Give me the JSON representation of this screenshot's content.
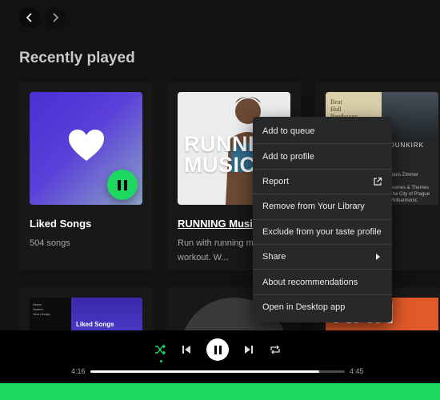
{
  "section": {
    "title": "Recently played"
  },
  "cards": [
    {
      "title": "Liked Songs",
      "subtitle": "504 songs"
    },
    {
      "title": "RUNNING Music",
      "subtitle": "Run with running m... in your workout. W...",
      "cover_text": "RUNNING MUSIC"
    },
    {
      "title": "",
      "subtitle": "",
      "cover_text": "DUNKIRK",
      "credit1": "Hans Zimmer",
      "credit2": "Scenes & Themes",
      "credit3": "The City of Prague Philharmonic Orchestra"
    }
  ],
  "thumbs": {
    "liked_label": "Liked Songs",
    "menu_lines": "Home\nSearch\nYour Library",
    "orange_text": "RAN"
  },
  "context_menu": {
    "items": [
      {
        "label": "Add to queue",
        "icon": ""
      },
      {
        "label": "Add to profile",
        "icon": ""
      },
      {
        "label": "Report",
        "icon": "external-link-icon"
      },
      {
        "label": "Remove from Your Library",
        "icon": ""
      },
      {
        "label": "Exclude from your taste profile",
        "icon": ""
      },
      {
        "label": "Share",
        "icon": "chevron-right-icon"
      },
      {
        "label": "About recommendations",
        "icon": ""
      },
      {
        "label": "Open in Desktop app",
        "icon": ""
      }
    ]
  },
  "player": {
    "elapsed": "4:16",
    "total": "4:45",
    "progress_fraction": 0.9,
    "shuffle_active": true
  },
  "colors": {
    "accent": "#1ed760",
    "background": "#121212",
    "card": "#181818",
    "menu": "#282828"
  }
}
